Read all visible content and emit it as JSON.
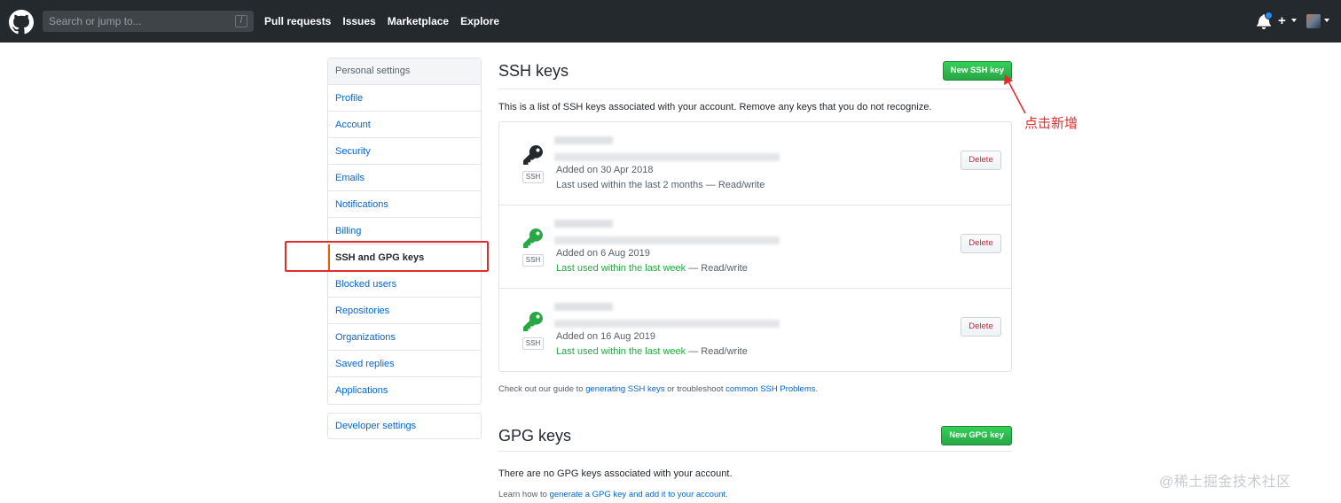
{
  "header": {
    "search_placeholder": "Search or jump to...",
    "search_shortcut": "/",
    "nav": [
      "Pull requests",
      "Issues",
      "Marketplace",
      "Explore"
    ],
    "plus_label": "+",
    "icons": [
      "github-logo-icon",
      "bell-icon",
      "plus-icon",
      "avatar"
    ]
  },
  "sidebar": {
    "title": "Personal settings",
    "items": [
      {
        "label": "Profile"
      },
      {
        "label": "Account"
      },
      {
        "label": "Security"
      },
      {
        "label": "Emails"
      },
      {
        "label": "Notifications"
      },
      {
        "label": "Billing"
      },
      {
        "label": "SSH and GPG keys",
        "selected": true
      },
      {
        "label": "Blocked users"
      },
      {
        "label": "Repositories"
      },
      {
        "label": "Organizations"
      },
      {
        "label": "Saved replies"
      },
      {
        "label": "Applications"
      }
    ],
    "developer_settings": "Developer settings"
  },
  "ssh": {
    "title": "SSH keys",
    "new_button": "New SSH key",
    "intro": "This is a list of SSH keys associated with your account. Remove any keys that you do not recognize.",
    "badge": "SSH",
    "delete_label": "Delete",
    "keys": [
      {
        "added": "Added on 30 Apr 2018",
        "used_prefix": "Last used within the last 2 months",
        "used_suffix": " — Read/write",
        "recent": false,
        "icon_color": "#24292e"
      },
      {
        "added": "Added on 6 Aug 2019",
        "used_prefix": "Last used within the last week",
        "used_suffix": " — Read/write",
        "recent": true,
        "icon_color": "#28a745"
      },
      {
        "added": "Added on 16 Aug 2019",
        "used_prefix": "Last used within the last week",
        "used_suffix": " — Read/write",
        "recent": true,
        "icon_color": "#28a745"
      }
    ],
    "guide": {
      "prefix": "Check out our guide to ",
      "link1": "generating SSH keys",
      "middle": " or troubleshoot ",
      "link2": "common SSH Problems",
      "suffix": "."
    }
  },
  "gpg": {
    "title": "GPG keys",
    "new_button": "New GPG key",
    "none": "There are no GPG keys associated with your account.",
    "learn_prefix": "Learn how to ",
    "learn_link": "generate a GPG key and add it to your account",
    "learn_suffix": "."
  },
  "annotation": {
    "text": "点击新增",
    "color": "#e02d2d"
  },
  "watermark": "@稀土掘金技术社区",
  "colors": {
    "header_bg": "#24292e",
    "link": "#0366d6",
    "green": "#28a745",
    "danger": "#cb2431",
    "annotation_red": "#e02d2d"
  }
}
